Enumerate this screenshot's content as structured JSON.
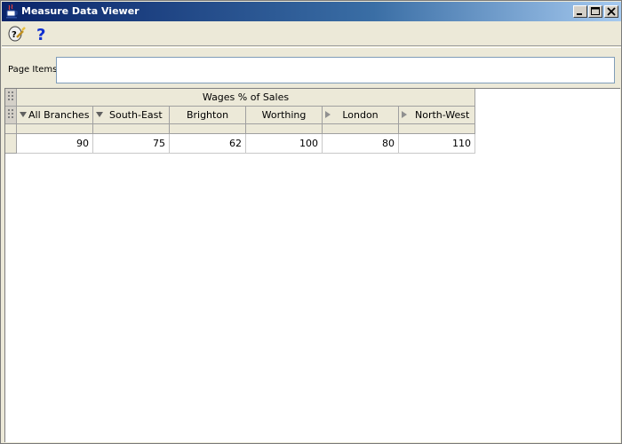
{
  "window": {
    "title": "Measure Data Viewer"
  },
  "toolbar": {
    "icons": [
      "query-wizard-icon",
      "help-icon"
    ]
  },
  "page_items": {
    "label": "Page Items",
    "value": ""
  },
  "table": {
    "measure_header": "Wages % of Sales",
    "columns": [
      {
        "label": "All Branches",
        "indicator": "expanded"
      },
      {
        "label": "South-East",
        "indicator": "expanded"
      },
      {
        "label": "Brighton",
        "indicator": "none"
      },
      {
        "label": "Worthing",
        "indicator": "none"
      },
      {
        "label": "London",
        "indicator": "collapsed"
      },
      {
        "label": "North-West",
        "indicator": "collapsed"
      }
    ],
    "rows": [
      [
        "90",
        "75",
        "62",
        "100",
        "80",
        "110"
      ]
    ]
  }
}
